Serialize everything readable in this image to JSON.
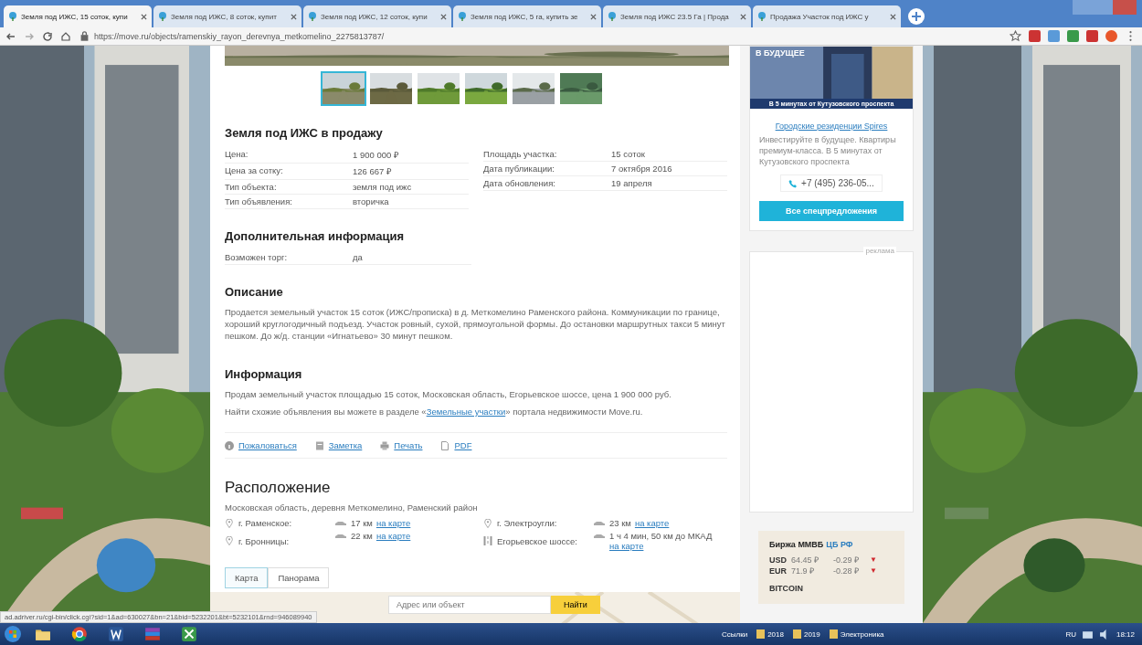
{
  "browser": {
    "tabs": [
      {
        "title": "Земля под ИЖС, 15 соток, купи",
        "selected": true
      },
      {
        "title": "Земля под ИЖС, 8 соток, купит",
        "selected": false
      },
      {
        "title": "Земля под ИЖС, 12 соток, купи",
        "selected": false
      },
      {
        "title": "Земля под ИЖС, 5 га, купить зе",
        "selected": false
      },
      {
        "title": "Земля под ИЖС 23.5 Га | Прода",
        "selected": false
      },
      {
        "title": "Продажа Участок под ИЖС у",
        "selected": false
      }
    ],
    "url": "https://move.ru/objects/ramenskiy_rayon_derevnya_metkomelino_2275813787/"
  },
  "gallery": {
    "thumbnails": [
      {
        "kind": "picture",
        "selected": true
      },
      {
        "kind": "picture",
        "selected": false
      },
      {
        "kind": "picture",
        "selected": false
      },
      {
        "kind": "picture",
        "selected": false
      },
      {
        "kind": "picture",
        "selected": false
      },
      {
        "kind": "picture",
        "selected": false
      }
    ]
  },
  "details": {
    "title": "Земля под ИЖС в продажу",
    "left": [
      {
        "label": "Цена:",
        "value": "1 900 000 ₽"
      },
      {
        "label": "Цена за сотку:",
        "value": "126 667 ₽"
      },
      {
        "label": "Тип объекта:",
        "value": "земля под ижс"
      },
      {
        "label": "Тип объявления:",
        "value": "вторичка"
      }
    ],
    "right": [
      {
        "label": "Площадь участка:",
        "value": "15 соток"
      },
      {
        "label": "Дата публикации:",
        "value": "7 октября 2016"
      },
      {
        "label": "Дата обновления:",
        "value": "19 апреля"
      }
    ]
  },
  "extra": {
    "title": "Дополнительная информация",
    "rows": [
      {
        "label": "Возможен торг:",
        "value": "да"
      }
    ]
  },
  "description": {
    "title": "Описание",
    "text": "Продается земельный участок 15 соток (ИЖС/прописка) в д. Меткомелино Раменского района. Коммуникации по границе, хороший круглогодичный подъезд. Участок ровный, сухой, прямоугольной формы. До остановки маршрутных такси 5 минут пешком. До ж/д. станции «Игнатьево» 30 минут пешком."
  },
  "information": {
    "title": "Информация",
    "text": "Продам земельный участок площадью 15 соток, Московская область, Егорьевское шоссе, цена 1 900 000 руб.",
    "hint_before": "Найти схожие объявления вы можете в разделе «",
    "hint_link": "Земельные участки",
    "hint_after": "» портала недвижимости Move.ru."
  },
  "actions": [
    {
      "kind": "complain",
      "label": "Пожаловаться"
    },
    {
      "kind": "note",
      "label": "Заметка"
    },
    {
      "kind": "print",
      "label": "Печать"
    },
    {
      "kind": "pdf",
      "label": "PDF"
    }
  ],
  "location": {
    "title": "Расположение",
    "address": "Московская область, деревня Меткомелино, Раменский район",
    "places": [
      {
        "kind": "pin",
        "name": "г. Раменское:",
        "distance": "17 км",
        "link": "на карте"
      },
      {
        "kind": "pin",
        "name": "г. Электроугли:",
        "distance": "23 км",
        "link": "на карте"
      },
      {
        "kind": "pin",
        "name": "г. Бронницы:",
        "distance": "22 км",
        "link": "на карте"
      },
      {
        "kind": "road",
        "name": "Егорьевское шоссе:",
        "distance": "1 ч 4 мин, 50 км до МКАД",
        "link": "на карте"
      }
    ]
  },
  "map": {
    "tabs": [
      {
        "label": "Карта",
        "selected": true
      },
      {
        "label": "Панорама",
        "selected": false
      }
    ],
    "search": {
      "placeholder": "Адрес или объект"
    },
    "button": "Найти"
  },
  "sidebar": {
    "banner": {
      "headline": "В БУДУЩЕЕ",
      "caption": "В 5 минутах от Кутузовского проспекта"
    },
    "link": "Городские резиденции Spires",
    "text": "Инвестируйте в будущее. Квартиры премиум-класса. В 5 минутах от Кутузовского проспекта",
    "phone": "+7 (495) 236-05...",
    "button": "Все спецпредложения",
    "ad_label": "реклама",
    "exchange": {
      "title": "Биржа ММВБ",
      "source": "ЦБ РФ",
      "rates": [
        {
          "currency": "USD",
          "value": "64.45 ₽",
          "change": "-0.29 ₽",
          "arrow": "▼"
        },
        {
          "currency": "EUR",
          "value": "71.9 ₽",
          "change": "-0.28 ₽",
          "arrow": "▼"
        }
      ],
      "next": "BITCOIN"
    }
  },
  "status_url": "ad.adriver.ru/cgi-bin/click.cgi?sid=1&ad=630027&bn=21&bid=5232201&bt=5232101&rnd=946089940",
  "taskbar": {
    "apps": [
      {
        "kind": "explorer"
      },
      {
        "kind": "chrome"
      },
      {
        "kind": "word"
      },
      {
        "kind": "archive"
      },
      {
        "kind": "spreadsheet"
      }
    ],
    "toolbar": "Ссылки",
    "folders": [
      "2018",
      "2019",
      "Электроника"
    ],
    "lang": "RU",
    "time": "18:12"
  }
}
